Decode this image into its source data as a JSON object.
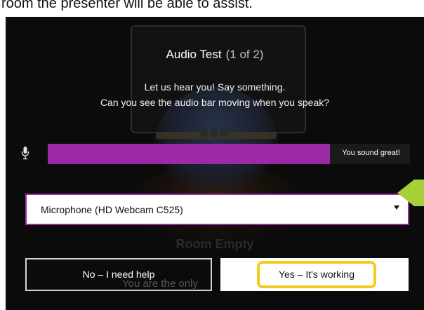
{
  "page": {
    "top_text": "room the presenter will be able to assist."
  },
  "dialog": {
    "title": "Audio Test",
    "step": "(1 of 2)",
    "instruction_1": "Let us hear you! Say something.",
    "instruction_2": "Can you see the audio bar moving when you speak?"
  },
  "audio_meter": {
    "level_percent": 78,
    "status_text": "You sound great!",
    "fill_color": "#9c2aa6",
    "icon": "microphone-icon"
  },
  "microphone_select": {
    "selected": "Microphone (HD Webcam C525)",
    "border_color": "#9c2aa6",
    "icon": "caret-down-icon"
  },
  "buttons": {
    "no_label": "No – I need help",
    "yes_label": "Yes – It's working",
    "highlight_color": "#f3cc1a"
  },
  "background": {
    "room_status": "Room Empty",
    "occupancy_text": "You are the only"
  },
  "annotation": {
    "arrow_color": "#a6cf38",
    "icon": "pointer-arrow-icon"
  }
}
